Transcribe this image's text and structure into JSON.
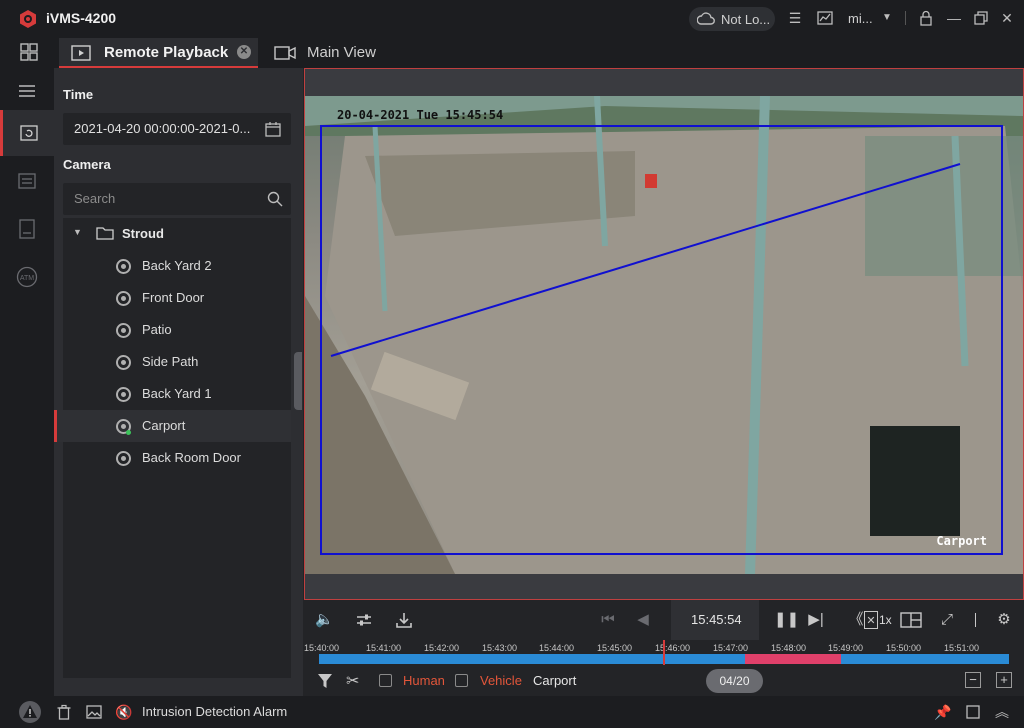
{
  "app": {
    "title": "iVMS-4200"
  },
  "titlebar": {
    "cloud_status": "Not Lo...",
    "user": "mi..."
  },
  "tabs": [
    {
      "label": "Remote Playback",
      "active": true
    },
    {
      "label": "Main View",
      "active": false
    }
  ],
  "panel": {
    "time_title": "Time",
    "time_range": "2021-04-20 00:00:00-2021-0...",
    "camera_title": "Camera",
    "search_placeholder": "Search",
    "group": "Stroud",
    "cameras": [
      {
        "label": "Back Yard 2"
      },
      {
        "label": "Front Door"
      },
      {
        "label": "Patio"
      },
      {
        "label": "Side Path"
      },
      {
        "label": "Back Yard 1"
      },
      {
        "label": "Carport",
        "selected": true
      },
      {
        "label": "Back Room Door"
      }
    ]
  },
  "video": {
    "osd_datetime": "20-04-2021 Tue 15:45:54",
    "osd_name": "Carport"
  },
  "controls": {
    "current_time": "15:45:54",
    "speed": "1x"
  },
  "timeline": {
    "labels": [
      "15:40:00",
      "15:41:00",
      "15:42:00",
      "15:43:00",
      "15:44:00",
      "15:45:00",
      "15:46:00",
      "15:47:00",
      "15:48:00",
      "15:49:00",
      "15:50:00",
      "15:51:00"
    ],
    "colors": {
      "normal": "#2a8bd6",
      "event": "#e0406a",
      "cursor": "#d63b3b"
    }
  },
  "filters": {
    "human": "Human",
    "vehicle": "Vehicle",
    "camera_name": "Carport",
    "page": "04/20",
    "human_color": "#e2563a",
    "vehicle_color": "#e2563a"
  },
  "statusbar": {
    "alarm_text": "Intrusion Detection Alarm"
  },
  "colors": {
    "accent": "#d63b3b",
    "bg": "#232427",
    "panel": "#2d2e32"
  }
}
